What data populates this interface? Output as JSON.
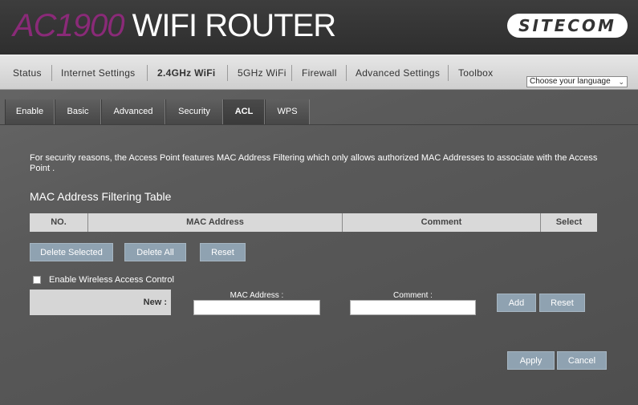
{
  "header": {
    "title_model": "AC1900",
    "title_rest": " WIFI ROUTER",
    "logo": "SITECOM"
  },
  "mainnav": {
    "items": [
      "Status",
      "Internet Settings",
      "2.4GHz WiFi",
      "5GHz WiFi",
      "Firewall",
      "Advanced Settings",
      "Toolbox"
    ],
    "active": "2.4GHz WiFi",
    "language_select": "Choose your language"
  },
  "subnav": {
    "tabs": [
      "Enable",
      "Basic",
      "Advanced",
      "Security",
      "ACL",
      "WPS"
    ],
    "active": "ACL"
  },
  "content": {
    "description": "For security reasons, the Access Point features MAC Address Filtering which only allows authorized MAC Addresses to associate with the Access Point .",
    "table_title": "MAC Address Filtering Table",
    "columns": [
      "NO.",
      "MAC Address",
      "Comment",
      "Select"
    ],
    "buttons": {
      "delete_selected": "Delete Selected",
      "delete_all": "Delete All",
      "reset": "Reset"
    },
    "enable_label": "Enable Wireless Access Control",
    "enable_checked": false,
    "new_label": "New :",
    "mac_label": "MAC Address :",
    "mac_value": "",
    "comment_label": "Comment :",
    "comment_value": "",
    "add": "Add",
    "reset2": "Reset",
    "apply": "Apply",
    "cancel": "Cancel"
  },
  "colors": {
    "accent": "#8a2a78",
    "button": "#8fa2b1",
    "table_header": "#d9d9d9"
  }
}
